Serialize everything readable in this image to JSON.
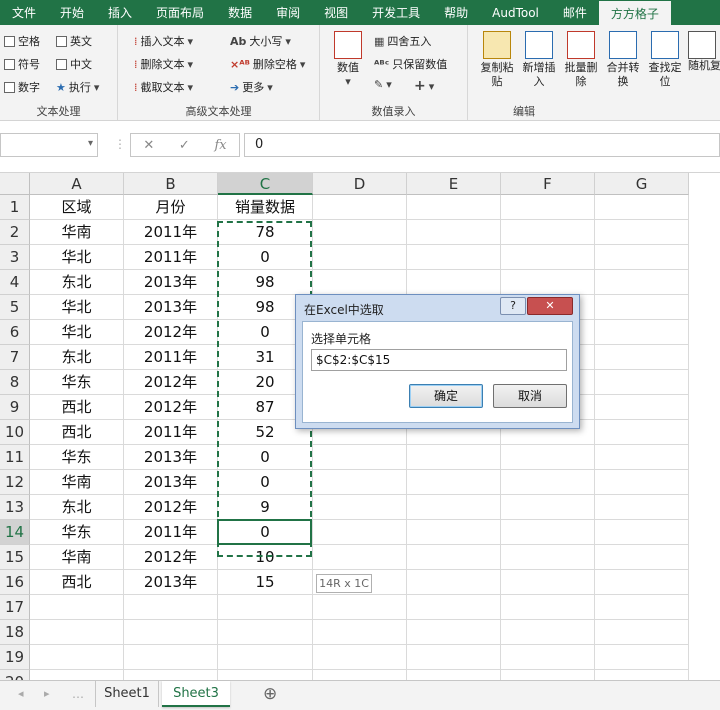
{
  "ribbon_tabs": [
    "文件",
    "开始",
    "插入",
    "页面布局",
    "数据",
    "审阅",
    "视图",
    "开发工具",
    "帮助",
    "AudTool",
    "邮件",
    "方方格子"
  ],
  "active_tab_index": 11,
  "groups": {
    "text_processing": {
      "label": "文本处理",
      "checks": [
        "空格",
        "英文",
        "符号",
        "中文",
        "数字"
      ],
      "execute": "执行"
    },
    "advanced_text": {
      "label": "高级文本处理",
      "items": [
        "插入文本",
        "删除文本",
        "截取文本",
        "大小写",
        "删除空格",
        "更多"
      ]
    },
    "numeric_entry": {
      "label": "数值录入",
      "big": "数值",
      "items": [
        "四舍五入",
        "只保留数值"
      ]
    },
    "edit": {
      "label": "编辑",
      "buttons": [
        "复制粘贴",
        "新增插入",
        "批量删除",
        "合并转换",
        "查找定位",
        "随机复"
      ]
    }
  },
  "formula_bar": {
    "value": "0",
    "cancel": "✕",
    "confirm": "✓",
    "fx": "fx"
  },
  "columns": [
    "A",
    "B",
    "C",
    "D",
    "E",
    "F",
    "G"
  ],
  "rows": [
    [
      "区域",
      "月份",
      "销量数据"
    ],
    [
      "华南",
      "2011年",
      "78"
    ],
    [
      "华北",
      "2011年",
      "0"
    ],
    [
      "东北",
      "2013年",
      "98"
    ],
    [
      "华北",
      "2013年",
      "98"
    ],
    [
      "华北",
      "2012年",
      "0"
    ],
    [
      "东北",
      "2011年",
      "31"
    ],
    [
      "华东",
      "2012年",
      "20"
    ],
    [
      "西北",
      "2012年",
      "87"
    ],
    [
      "西北",
      "2011年",
      "52"
    ],
    [
      "华东",
      "2013年",
      "0"
    ],
    [
      "华南",
      "2013年",
      "0"
    ],
    [
      "东北",
      "2012年",
      "9"
    ],
    [
      "华东",
      "2011年",
      "0"
    ],
    [
      "华南",
      "2012年",
      "10"
    ],
    [
      "西北",
      "2013年",
      "15"
    ],
    [
      "",
      "",
      ""
    ],
    [
      "",
      "",
      ""
    ],
    [
      "",
      "",
      ""
    ],
    [
      "",
      "",
      ""
    ]
  ],
  "selection_tip": "14R x 1C",
  "sheets": [
    "Sheet1",
    "Sheet3"
  ],
  "active_sheet": "Sheet3",
  "add_sheet": "⊕",
  "dialog": {
    "title": "在Excel中选取",
    "help": "?",
    "close": "✕",
    "label": "选择单元格",
    "value": "$C$2:$C$15",
    "ok": "确定",
    "cancel": "取消"
  },
  "colors": {
    "accent": "#217346",
    "dialog_frame": "#cddcf0",
    "close_red": "#c75050"
  }
}
